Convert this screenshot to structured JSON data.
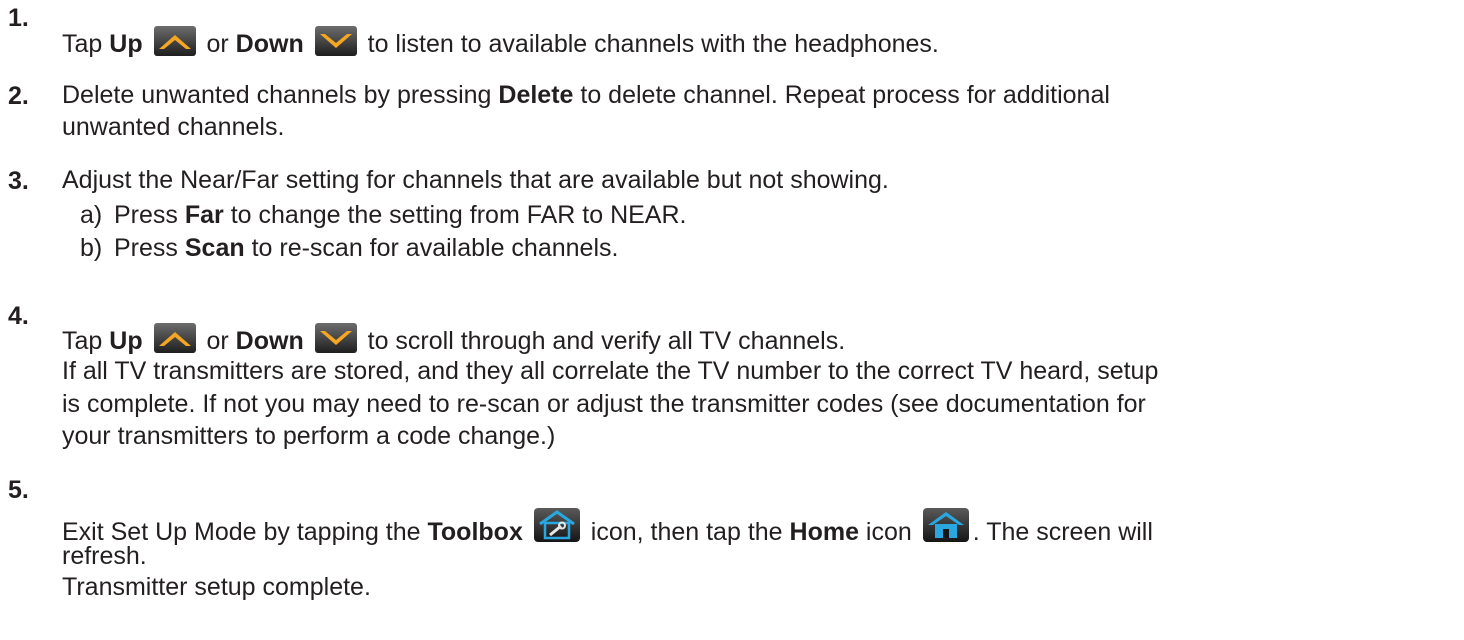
{
  "steps": [
    {
      "number": "1.",
      "parts": {
        "t1": "Tap ",
        "b1": "Up",
        "t2": " or ",
        "b2": "Down",
        "t3": " to listen to available channels with the headphones."
      },
      "icons": [
        "chevron-up-icon",
        "chevron-down-icon"
      ]
    },
    {
      "number": "2.",
      "line1": {
        "t1": "Delete unwanted channels by pressing ",
        "b1": "Delete",
        "t2": " to delete channel. Repeat process for additional"
      },
      "line2": "unwanted channels."
    },
    {
      "number": "3.",
      "line1": "Adjust the Near/Far setting for channels that are available but not showing.",
      "sub": [
        {
          "label": "a)",
          "t1": "Press ",
          "b1": "Far",
          "t2": " to change the setting from FAR to NEAR."
        },
        {
          "label": "b)",
          "t1": "Press ",
          "b1": "Scan",
          "t2": " to re-scan for available channels."
        }
      ]
    },
    {
      "number": "4.",
      "line1": {
        "t1": "Tap ",
        "b1": "Up",
        "t2": " or ",
        "b2": "Down",
        "t3": " to scroll through and verify all TV channels."
      },
      "line2": "If all TV transmitters are stored, and they all correlate the TV number to the correct TV heard, setup",
      "line3": "is complete. If not you may need to re-scan or adjust the transmitter codes (see documentation for",
      "line4": "your transmitters to perform a code change.)",
      "icons": [
        "chevron-up-icon",
        "chevron-down-icon"
      ]
    },
    {
      "number": "5.",
      "line1": {
        "t1": "Exit Set Up Mode by tapping the ",
        "b1": "Toolbox",
        "t2": " icon, then tap the ",
        "b2": "Home",
        "t3": " icon",
        "t4": ". The screen will"
      },
      "line2": "refresh.",
      "line3": "Transmitter setup complete.",
      "icons": [
        "toolbox-icon",
        "home-icon"
      ]
    }
  ],
  "colors": {
    "text": "#231f20",
    "arrow_orange": "#f5a623",
    "icon_blue": "#2aa7e0",
    "icon_dark": "#2a2a2a"
  }
}
